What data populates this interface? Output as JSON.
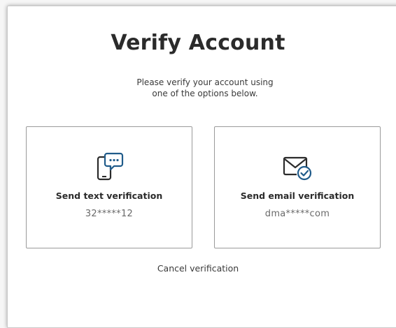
{
  "page": {
    "title": "Verify Account",
    "subtitle": "Please verify your account using one of the options below."
  },
  "options": [
    {
      "icon": "phone-chat-icon",
      "label": "Send text verification",
      "masked_value": "32*****12"
    },
    {
      "icon": "email-check-icon",
      "label": "Send email verification",
      "masked_value": "dma*****com"
    }
  ],
  "actions": {
    "cancel_label": "Cancel verification"
  },
  "colors": {
    "icon_dark": "#2b2b2b",
    "icon_accent": "#1f5b8a",
    "border": "#9a9a9a"
  }
}
